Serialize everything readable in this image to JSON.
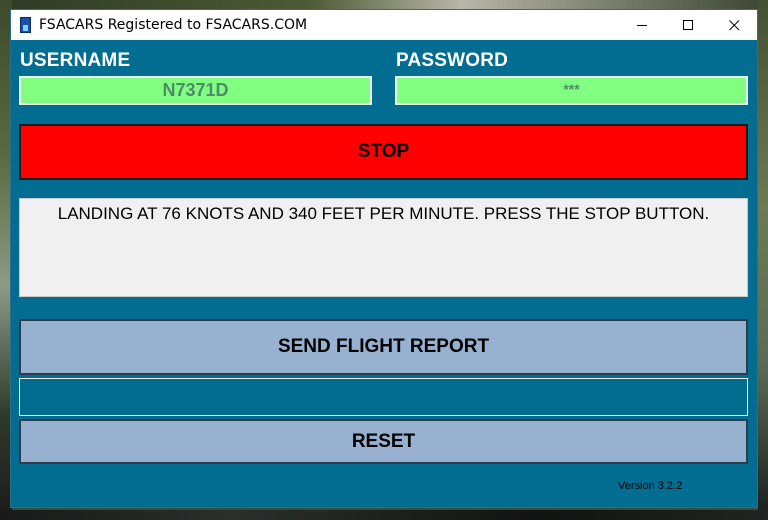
{
  "window": {
    "title": "FSACARS Registered to FSACARS.COM"
  },
  "login": {
    "username_label": "USERNAME",
    "username_value": "N7371D",
    "password_label": "PASSWORD",
    "password_value": "***"
  },
  "stop_button": {
    "label": "STOP",
    "color": "#ff0000"
  },
  "message": {
    "text": "LANDING AT 76 KNOTS AND 340 FEET PER MINUTE. PRESS THE STOP BUTTON."
  },
  "send_report_button": {
    "label": "SEND FLIGHT REPORT"
  },
  "status_bar": {
    "text": ""
  },
  "reset_button": {
    "label": "RESET"
  },
  "footer": {
    "version": "Version 3.2.2"
  },
  "colors": {
    "window_bg": "#036c91",
    "field_bg": "#80ff80",
    "button_bg": "#97b2d0"
  },
  "icons": {
    "app": "fsacars-app-icon",
    "minimize": "minimize-icon",
    "maximize": "maximize-icon",
    "close": "close-icon"
  }
}
